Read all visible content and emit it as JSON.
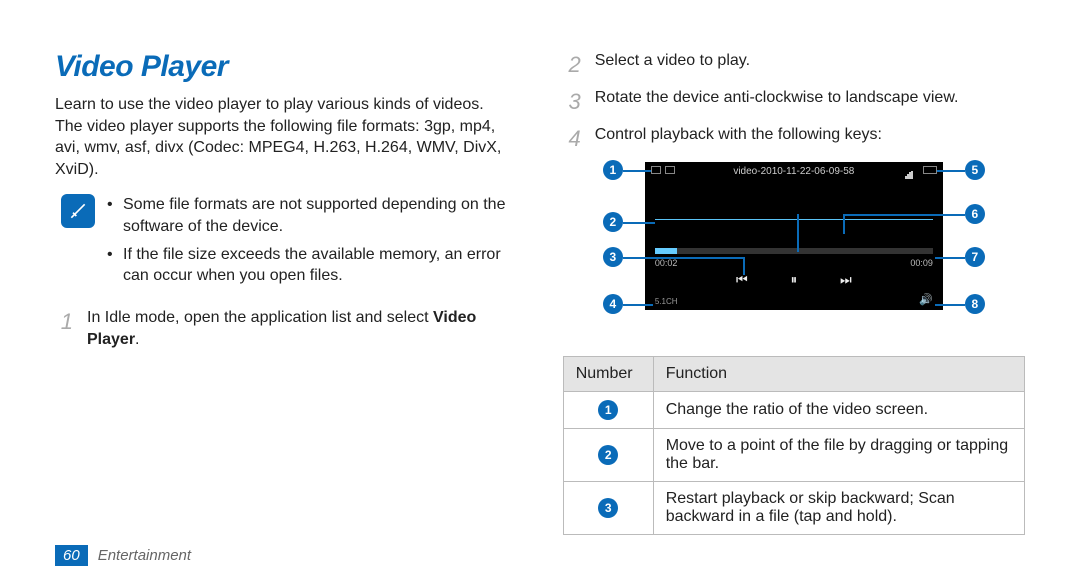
{
  "heading": "Video Player",
  "intro": "Learn to use the video player to play various kinds of videos. The video player supports the following file formats: 3gp, mp4, avi, wmv, asf, divx (Codec: MPEG4, H.263, H.264, WMV, DivX, XviD).",
  "notes": [
    "Some file formats are not supported depending on the software of the device.",
    "If the file size exceeds the available memory, an error can occur when you open files."
  ],
  "steps": [
    {
      "n": "1",
      "text_a": "In Idle mode, open the application list and select ",
      "text_b": "Video Player",
      "text_c": "."
    },
    {
      "n": "2",
      "text_a": "Select a video to play."
    },
    {
      "n": "3",
      "text_a": "Rotate the device anti-clockwise to landscape view."
    },
    {
      "n": "4",
      "text_a": "Control playback with the following keys:"
    }
  ],
  "video": {
    "title": "video-2010-11-22-06-09-58",
    "time_elapsed": "00:02",
    "time_total": "00:09",
    "srs": "5.1CH"
  },
  "callouts": [
    "1",
    "2",
    "3",
    "4",
    "5",
    "6",
    "7",
    "8"
  ],
  "table": {
    "headers": [
      "Number",
      "Function"
    ],
    "rows": [
      {
        "n": "1",
        "fn": "Change the ratio of the video screen."
      },
      {
        "n": "2",
        "fn": "Move to a point of the file by dragging or tapping the bar."
      },
      {
        "n": "3",
        "fn": "Restart playback or skip backward; Scan backward in a file (tap and hold)."
      }
    ]
  },
  "footer": {
    "page": "60",
    "section": "Entertainment"
  }
}
